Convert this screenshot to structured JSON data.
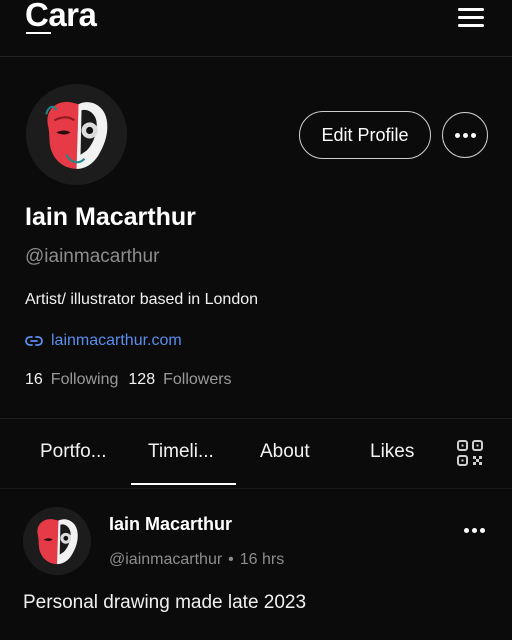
{
  "app": {
    "logo": "Cara"
  },
  "header": {
    "menu_icon": "hamburger-menu-icon"
  },
  "profile": {
    "name": "Iain Macarthur",
    "handle": "@iainmacarthur",
    "bio": "Artist/ illustrator based in London",
    "link": "lainmacarthur.com",
    "following_count": "16",
    "following_label": "Following",
    "followers_count": "128",
    "followers_label": "Followers",
    "edit_label": "Edit Profile"
  },
  "tabs": [
    {
      "label": "Portfo..."
    },
    {
      "label": "Timeli...",
      "active": true
    },
    {
      "label": "About"
    },
    {
      "label": "Likes"
    }
  ],
  "post": {
    "author": "Iain Macarthur",
    "handle": "@iainmacarthur",
    "separator": "•",
    "time": "16 hrs",
    "text": "Personal drawing made late 2023"
  },
  "colors": {
    "background": "#0b0b0b",
    "link": "#5b8def",
    "muted": "#8d8d8d"
  }
}
